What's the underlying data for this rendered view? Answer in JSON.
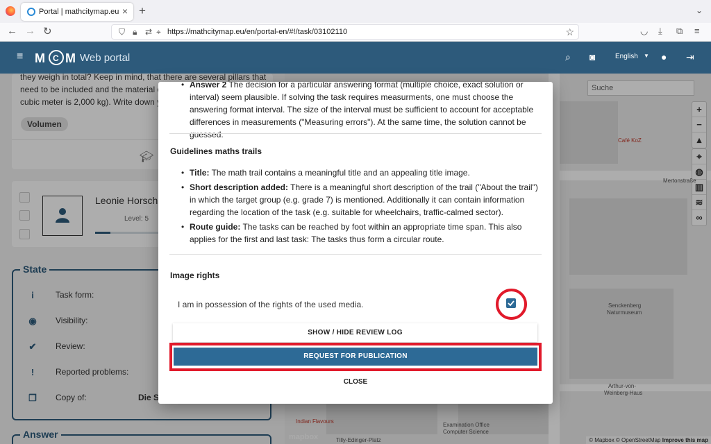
{
  "browser": {
    "tab_title": "Portal | mathcitymap.eu",
    "url": "https://mathcitymap.eu/en/portal-en/#!/task/03102110"
  },
  "header": {
    "logo": "MCM",
    "subtitle": "Web portal",
    "language": "English"
  },
  "task": {
    "text": "they weigh in total? Keep in mind, that there are several pillars that need to be included and the material of ... cubic meter is 2,000 kg). Write down yo...",
    "line1": "they weigh in total? Keep in mind, that there are several pillars that",
    "line2": "need to be included and the material of",
    "line3": "cubic meter is 2,000 kg). Write down yo",
    "tag": "Volumen"
  },
  "user": {
    "name": "Leonie Horsch",
    "level": "Level: 5",
    "progress": 0.2
  },
  "state": {
    "title": "State",
    "rows": [
      {
        "label": "Task form:"
      },
      {
        "label": "Visibility:"
      },
      {
        "label": "Review:"
      },
      {
        "label": "Reported problems:"
      },
      {
        "label": "Copy of:",
        "value": "Die S"
      }
    ]
  },
  "answer": {
    "title": "Answer"
  },
  "map": {
    "search_placeholder": "Suche",
    "labels": {
      "cafe": "Café KoZ",
      "street": "Mertonstraße",
      "museum1": "Senckenberg",
      "museum2": "Naturmuseum",
      "arthur1": "Arthur-von-",
      "arthur2": "Weinberg-Haus",
      "indian": "Indian Flavours",
      "exam1": "Examination Office",
      "exam2": "Computer Science",
      "platz": "Tilly-Edinger-Platz"
    },
    "mapbox": "mapbox",
    "attribution": "© Mapbox © OpenStreetMap",
    "improve": "Improve this map"
  },
  "modal": {
    "answer2_label": "Answer 2",
    "answer2_text": " The decision for a particular answering format (multiple choice, exact solution or interval) seem plausible. If solving the task requires measurments, one must choose the answering format interval. The size of the interval must be sufficient to account for acceptable differences in measurements (\"Measuring errors\"). At the same time, the solution cannot be guessed.",
    "guidelines_title": "Guidelines maths trails",
    "guidelines": [
      {
        "label": "Title:",
        "text": " The math trail contains a meaningful title and an appealing title image."
      },
      {
        "label": "Short description added:",
        "text": " There is a meaningful short description of the trail (\"About the trail\") in which the target group (e.g. grade 7) is mentioned. Additionally it can contain information regarding the location of the task (e.g. suitable for wheelchairs, traffic-calmed sector)."
      },
      {
        "label": "Route guide:",
        "text": " The tasks can be reached by foot within an appropriate time span. This also applies for the first and last task: The tasks thus form a circular route."
      }
    ],
    "image_rights_title": "Image rights",
    "rights_text": "I am in possession of the rights of the used media.",
    "rights_checked": true,
    "btn_log": "SHOW / HIDE REVIEW LOG",
    "btn_publish": "REQUEST FOR PUBLICATION",
    "btn_close": "CLOSE",
    "highlight_color": "#e11a2b",
    "accent_color": "#2d6a96"
  }
}
